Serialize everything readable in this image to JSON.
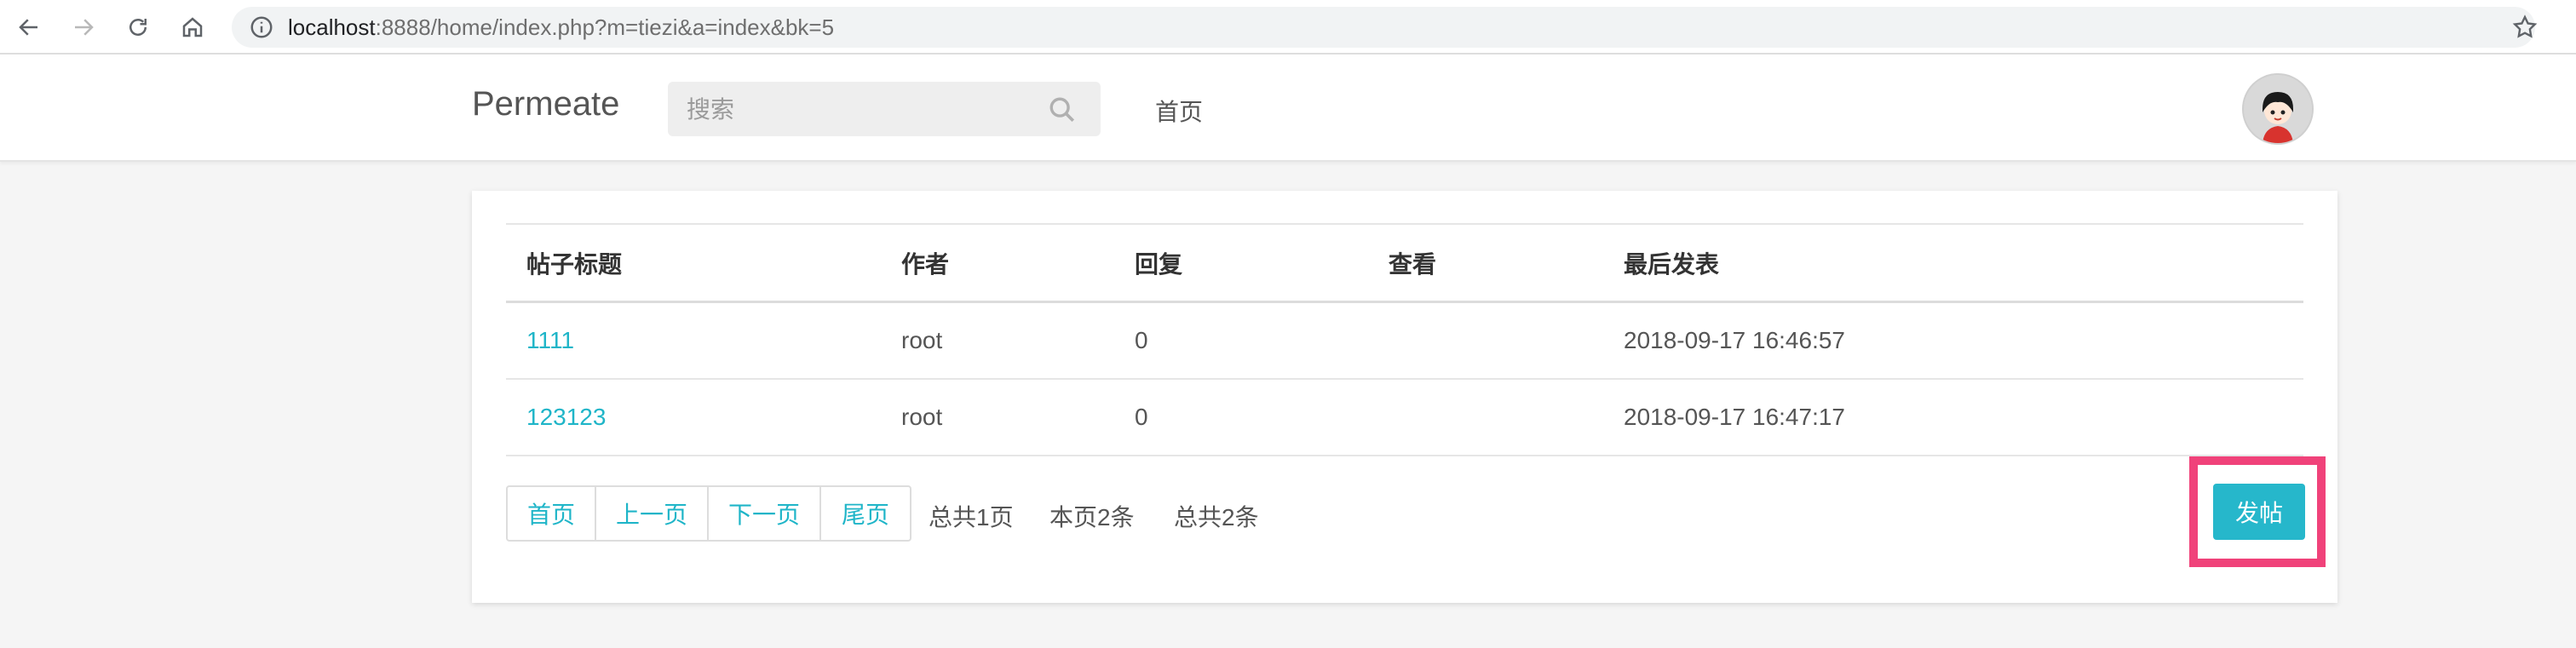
{
  "browser": {
    "url_host": "localhost",
    "url_rest": ":8888/home/index.php?m=tiezi&a=index&bk=5"
  },
  "header": {
    "brand": "Permeate",
    "search_placeholder": "搜索",
    "home_link": "首页"
  },
  "table": {
    "headers": [
      "帖子标题",
      "作者",
      "回复",
      "查看",
      "最后发表"
    ],
    "rows": [
      {
        "title": "1111",
        "author": "root",
        "replies": "0",
        "views": "",
        "last_post": "2018-09-17 16:46:57"
      },
      {
        "title": "123123",
        "author": "root",
        "replies": "0",
        "views": "",
        "last_post": "2018-09-17 16:47:17"
      }
    ]
  },
  "pager": {
    "first": "首页",
    "prev": "上一页",
    "next": "下一页",
    "last": "尾页",
    "total_pages": "总共1页",
    "this_page": "本页2条",
    "total_items": "总共2条"
  },
  "actions": {
    "post_button": "发帖"
  },
  "colors": {
    "accent": "#1fb5c8",
    "button": "#26b7cb",
    "highlight": "#f0427a"
  }
}
